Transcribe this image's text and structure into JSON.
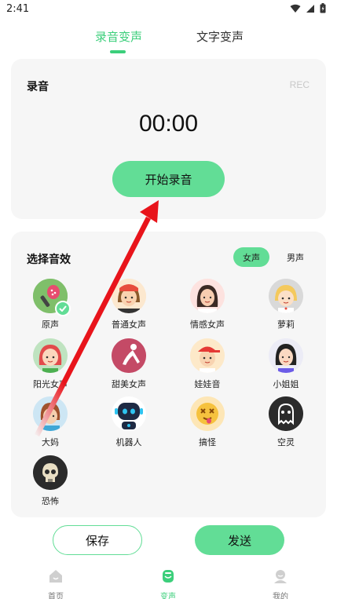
{
  "status_bar": {
    "time": "2:41",
    "icons": [
      "wifi-icon",
      "signal-icon",
      "battery-icon"
    ]
  },
  "tabs": {
    "active": "录音变声",
    "inactive": "文字变声"
  },
  "record": {
    "title": "录音",
    "tag": "REC",
    "timer": "00:00",
    "start_label": "开始录音"
  },
  "effects": {
    "title": "选择音效",
    "gender_female": "女声",
    "gender_male": "男声",
    "selected": "原声",
    "items": [
      {
        "label": "原声"
      },
      {
        "label": "普通女声"
      },
      {
        "label": "情感女声"
      },
      {
        "label": "萝莉"
      },
      {
        "label": "阳光女声"
      },
      {
        "label": "甜美女声"
      },
      {
        "label": "娃娃音"
      },
      {
        "label": "小姐姐"
      },
      {
        "label": "大妈"
      },
      {
        "label": "机器人"
      },
      {
        "label": "搞怪"
      },
      {
        "label": "空灵"
      },
      {
        "label": "恐怖"
      }
    ]
  },
  "actions": {
    "save_label": "保存",
    "send_label": "发送"
  },
  "bottom_nav": [
    {
      "label": "首页",
      "icon": "home-icon"
    },
    {
      "label": "变声",
      "icon": "voice-change-icon"
    },
    {
      "label": "我的",
      "icon": "profile-icon"
    }
  ],
  "colors": {
    "accent": "#62dd96",
    "accent_text": "#3ccf7b",
    "card_bg": "#f6f6f6",
    "arrow": "#e8141b"
  }
}
